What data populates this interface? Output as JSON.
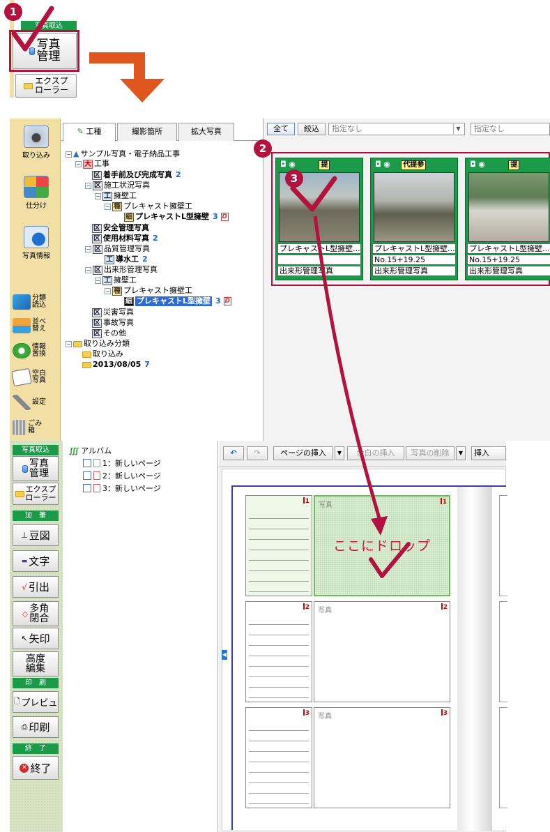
{
  "steps": {
    "one": "1",
    "two": "2",
    "three": "3"
  },
  "top_snippet": {
    "group_header": "写真取込",
    "photo_mgmt_button": "写真\n管理",
    "explorer_button": "エクスプ\nローラー"
  },
  "mid_window": {
    "sidebar": [
      {
        "label": "取り込み",
        "icon": "camera-icon"
      },
      {
        "label": "仕分け",
        "icon": "sort-icon"
      },
      {
        "label": "写真情報",
        "icon": "info-icon"
      }
    ],
    "small_tools": [
      {
        "label": "分類\n読込",
        "icon": "classify-load-icon"
      },
      {
        "label": "並べ\n替え",
        "icon": "reorder-icon"
      },
      {
        "label": "情報\n置換",
        "icon": "replace-icon"
      },
      {
        "label": "空白\n写真",
        "icon": "blank-photo-icon"
      },
      {
        "label": "設定",
        "icon": "wrench-icon"
      },
      {
        "label": "ごみ\n箱",
        "icon": "trash-icon"
      }
    ],
    "tabs": [
      "工種",
      "撮影箇所",
      "拡大写真"
    ],
    "tree": {
      "root": "サンプル写真・電子納品工事",
      "dai": "大",
      "koji": "工事",
      "ku": "区",
      "ko": "工",
      "shu": "種",
      "sai": "細",
      "chakushu": "着手前及び完成写真",
      "chakushu_count": "2",
      "sekou": "施工状況写真",
      "yoheki": "擁壁工",
      "precast": "プレキャスト擁壁工",
      "precast_l": "プレキャストL型擁壁",
      "precast_l_count": "3",
      "anzen": "安全管理写真",
      "shiyou": "使用材料写真",
      "shiyou_count": "2",
      "hinshitsu": "品質管理写真",
      "dosui": "導水工",
      "dosui_count": "2",
      "dekigata": "出来形管理写真",
      "saigai": "災害写真",
      "jiko": "事故写真",
      "sonota": "その他",
      "torikomi_bunrui": "取り込み分類",
      "torikomi": "取り込み",
      "date": "2013/08/05",
      "date_count": "7",
      "dflag": "D"
    },
    "photo_toolbar": {
      "all": "全て",
      "filter": "絞込",
      "combo1": "指定なし",
      "combo2": "指定なし"
    },
    "cards": [
      {
        "tags": "提",
        "line1": "プレキャストL型擁壁...",
        "line2": "",
        "line3": "出来形管理写真"
      },
      {
        "tags": "代提参",
        "line1": "プレキャストL型擁壁...",
        "line2": "No.15+19.25",
        "line3": "出来形管理写真"
      },
      {
        "tags": "提",
        "line1": "プレキャストL型擁壁...",
        "line2": "No.15+19.25",
        "line3": "出来形管理写真"
      }
    ]
  },
  "bottom_window": {
    "groups": {
      "photo_import": "写真取込",
      "annotate": "加　筆",
      "print": "印　刷",
      "exit": "終　了"
    },
    "buttons": {
      "photo_mgmt": "写真\n管理",
      "explorer": "エクスプ\nローラー",
      "mame_zu": "豆図",
      "moji": "文字",
      "hikidashi": "引出",
      "takaku": "多角\n閉合",
      "yajirushi": "矢印",
      "koudo": "高度\n編集",
      "preview": "プレビュ",
      "print": "印刷",
      "exit": "終了"
    },
    "album": {
      "root": "アルバム",
      "pages": [
        "1：新しいページ",
        "2：新しいページ",
        "3：新しいページ"
      ]
    },
    "toolbar": {
      "insert_page": "ページの挿入",
      "insert_blank": "余白の挿入",
      "delete_photo": "写真の削除",
      "insert": "挿入"
    },
    "book": {
      "photo_label": "写真",
      "drop_text": "ここにドロップ",
      "slot_numbers": [
        "1",
        "2",
        "3"
      ]
    }
  },
  "colors": {
    "accent": "#b3123f",
    "green": "#1b9a4a",
    "arrow_orange": "#e0561f"
  }
}
